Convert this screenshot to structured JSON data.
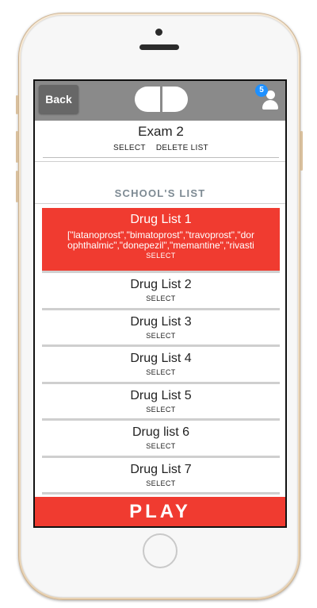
{
  "header": {
    "back_label": "Back",
    "notification_count": "5",
    "logo_icon": "capsule-logo-icon",
    "user_icon": "user-icon"
  },
  "exam": {
    "title": "Exam 2",
    "select_label": "SELECT",
    "delete_label": "DELETE LIST"
  },
  "section": {
    "title": "SCHOOL'S LIST"
  },
  "lists": [
    {
      "name": "Drug List 1",
      "drugs_line1": "[\"latanoprost\",\"bimatoprost\",\"travoprost\",\"dor",
      "drugs_line2": "ophthalmic\",\"donepezil\",\"memantine\",\"rivasti",
      "select_label": "SELECT",
      "active": true
    },
    {
      "name": "Drug List 2",
      "select_label": "SELECT"
    },
    {
      "name": "Drug List 3",
      "select_label": "SELECT"
    },
    {
      "name": "Drug List 4",
      "select_label": "SELECT"
    },
    {
      "name": "Drug List 5",
      "select_label": "SELECT"
    },
    {
      "name": "Drug list 6",
      "select_label": "SELECT"
    },
    {
      "name": "Drug List 7",
      "select_label": "SELECT"
    }
  ],
  "play": {
    "label": "PLAY"
  },
  "colors": {
    "accent_red": "#f03b30",
    "header_gray": "#8a8a8a",
    "badge_blue": "#1e90ff"
  }
}
